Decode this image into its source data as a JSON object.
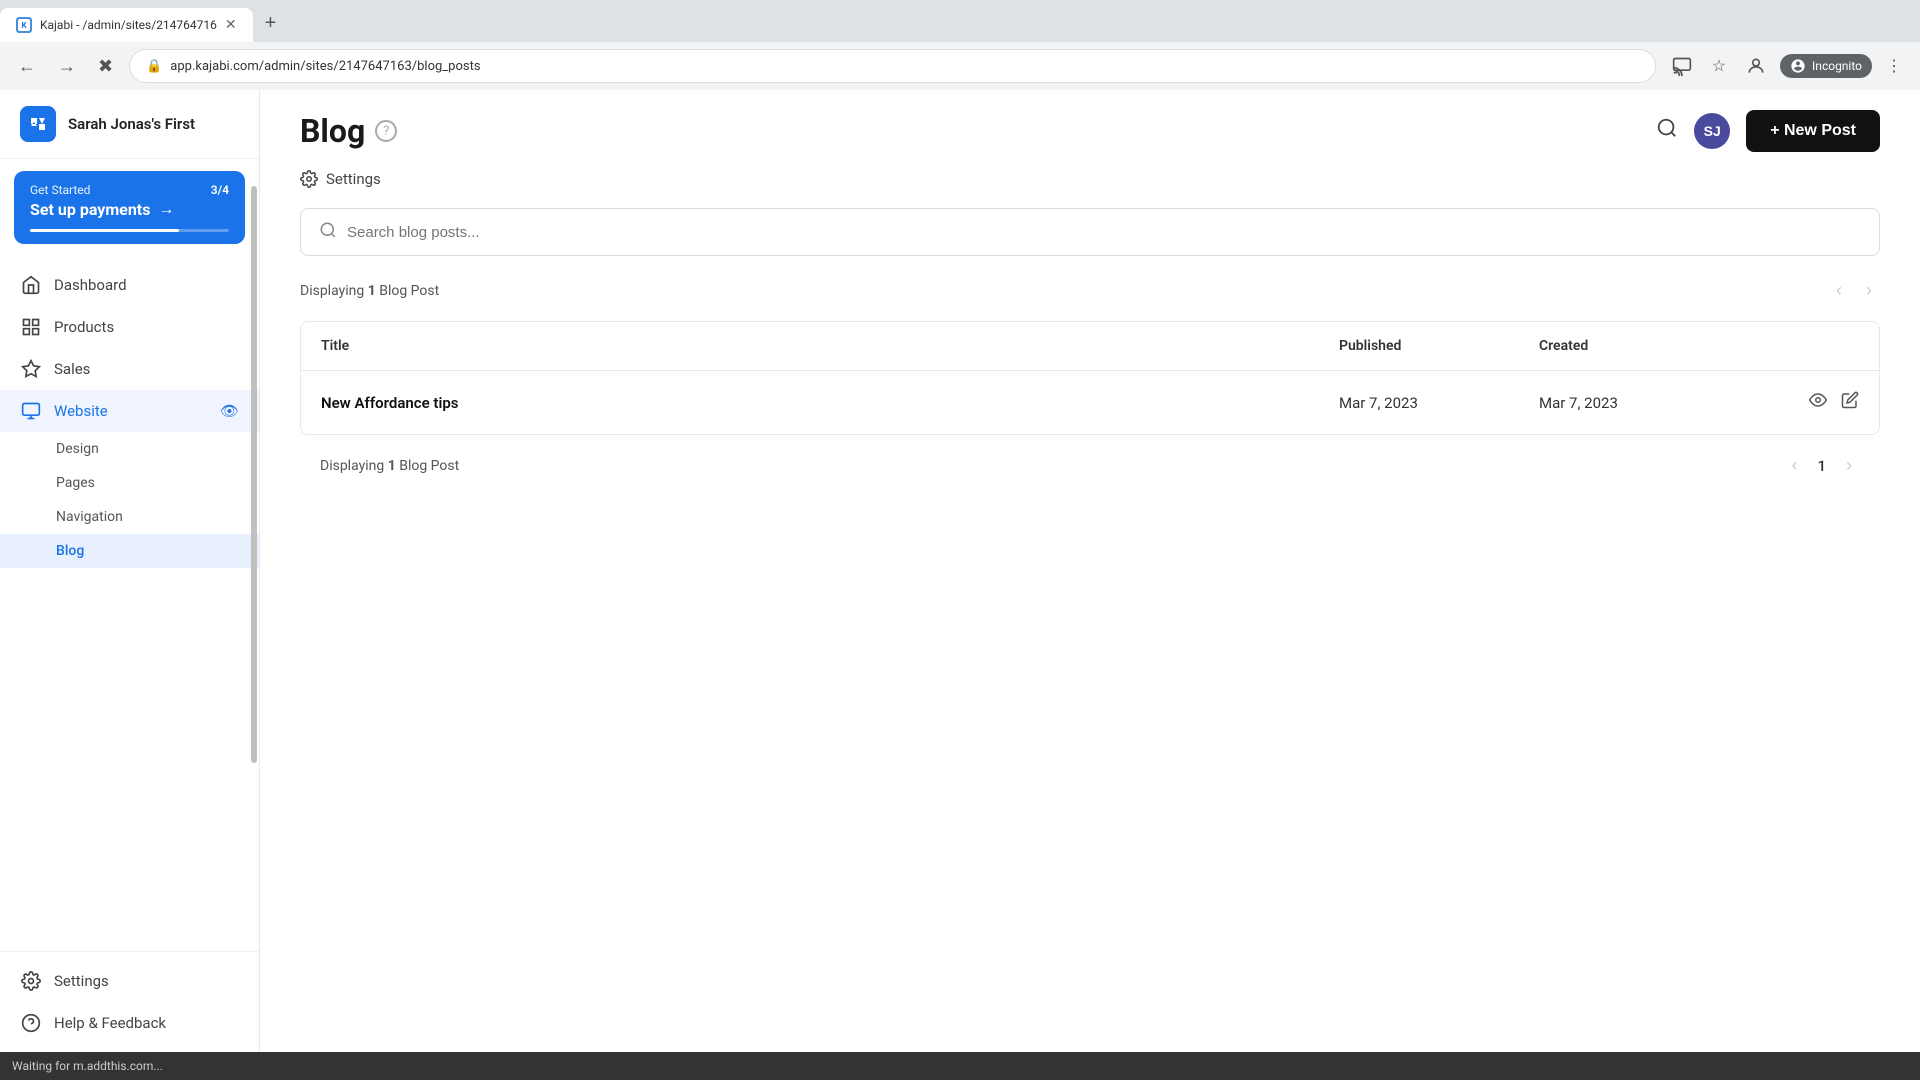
{
  "browser": {
    "tab_title": "Kajabi - /admin/sites/214764716",
    "tab_favicon": "K",
    "address": "app.kajabi.com/admin/sites/2147647163/blog_posts",
    "incognito_label": "Incognito",
    "loading": true
  },
  "sidebar": {
    "logo_letter": "K",
    "site_name": "Sarah Jonas's First",
    "get_started": {
      "label": "Get Started",
      "count": "3/4",
      "title": "Set up payments",
      "arrow": "→"
    },
    "nav_items": [
      {
        "id": "dashboard",
        "label": "Dashboard",
        "icon": "🏠",
        "active": false
      },
      {
        "id": "products",
        "label": "Products",
        "icon": "◇",
        "active": false
      },
      {
        "id": "sales",
        "label": "Sales",
        "icon": "◈",
        "active": false
      },
      {
        "id": "website",
        "label": "Website",
        "icon": "🖥",
        "active": true,
        "has_expand": true
      }
    ],
    "website_subitems": [
      {
        "id": "design",
        "label": "Design",
        "active": false
      },
      {
        "id": "pages",
        "label": "Pages",
        "active": false
      },
      {
        "id": "navigation",
        "label": "Navigation",
        "active": false
      },
      {
        "id": "blog",
        "label": "Blog",
        "active": true
      }
    ],
    "bottom_items": [
      {
        "id": "settings",
        "label": "Settings",
        "icon": "⚙"
      },
      {
        "id": "help",
        "label": "Help & Feedback",
        "icon": "?"
      }
    ]
  },
  "main": {
    "page_title": "Blog",
    "new_post_button": "+ New Post",
    "settings_link": "Settings",
    "search_placeholder": "Search blog posts...",
    "displaying_text_top": "Displaying ",
    "displaying_bold_top": "1",
    "displaying_suffix_top": " Blog Post",
    "columns": [
      {
        "label": "Title"
      },
      {
        "label": "Published"
      },
      {
        "label": "Created"
      },
      {
        "label": ""
      }
    ],
    "rows": [
      {
        "title": "New Affordance tips",
        "published": "Mar 7, 2023",
        "created": "Mar 7, 2023"
      }
    ],
    "displaying_text_bottom": "Displaying ",
    "displaying_bold_bottom": "1",
    "displaying_suffix_bottom": " Blog Post",
    "page_number": "1"
  },
  "status_bar": {
    "text": "Waiting for m.addthis.com..."
  }
}
